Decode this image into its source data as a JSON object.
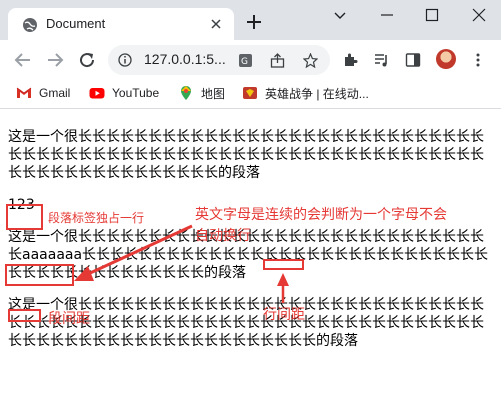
{
  "browser": {
    "tab_title": "Document",
    "url": "127.0.0.1:5...",
    "bookmarks": [
      {
        "label": "Gmail",
        "icon": "gmail-icon"
      },
      {
        "label": "YouTube",
        "icon": "youtube-icon"
      },
      {
        "label": "地图",
        "icon": "maps-icon"
      },
      {
        "label": "英雄战争 | 在线动...",
        "icon": "game-icon"
      }
    ]
  },
  "page": {
    "p1": "这是一个很长长长长长长长长长长长长长长长长长长长长长长长长长长长长长长长长长长长长长长长长长长长长长长长长长长长长长长长长长长长长长长长长长长长长长长长长长长长长长长的段落",
    "p2": "123",
    "p3": "这是一个很长长长长长长长长长长长长长长长长长长长长长长长长长长长长长长aaaaaaa长长长长长长长长长长长长长长长长长长长长长长长长长长长长长长长长长长长长长长长长长长长的段落",
    "p4": "这是一个很长长长长长长长长长长长长长长长长长长长长长长长长长长长长长长长长长长长长长长长长长长长长长长长长长长长长长长长长长长长长长长长长长长长长长长长长长长长长长长长长长长长长长的段落"
  },
  "annotations": {
    "paragraph_label": "段落标签独占一行",
    "english_note_line1": "英文字母是连续的会判断为一个字母不会",
    "english_note_line2": "自动换行",
    "line_spacing_label": "行间距",
    "paragraph_spacing_label": "段间距",
    "color": "#e53935"
  }
}
